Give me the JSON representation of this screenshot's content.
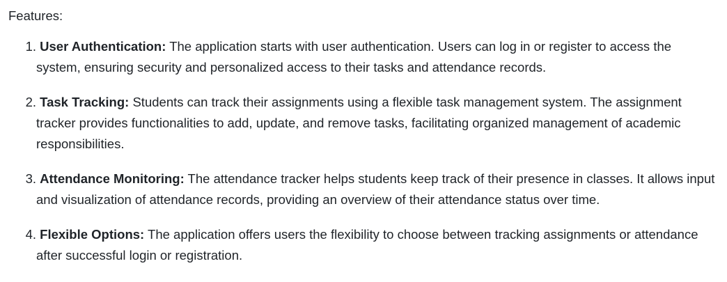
{
  "heading": "Features:",
  "features": [
    {
      "number": "1.",
      "title": "User Authentication:",
      "text": "The application starts with user authentication. Users can log in or register to access the system, ensuring security and personalized access to their tasks and attendance records."
    },
    {
      "number": "2.",
      "title": "Task Tracking:",
      "text": "Students can track their assignments using a flexible task management system. The assignment tracker provides functionalities to add, update, and remove tasks, facilitating organized management of academic responsibilities."
    },
    {
      "number": "3.",
      "title": "Attendance Monitoring:",
      "text": "The attendance tracker helps students keep track of their presence in classes. It allows input and visualization of attendance records, providing an overview of their attendance status over time."
    },
    {
      "number": "4.",
      "title": "Flexible Options:",
      "text": "The application offers users the flexibility to choose between tracking assignments or attendance after successful login or registration."
    }
  ]
}
